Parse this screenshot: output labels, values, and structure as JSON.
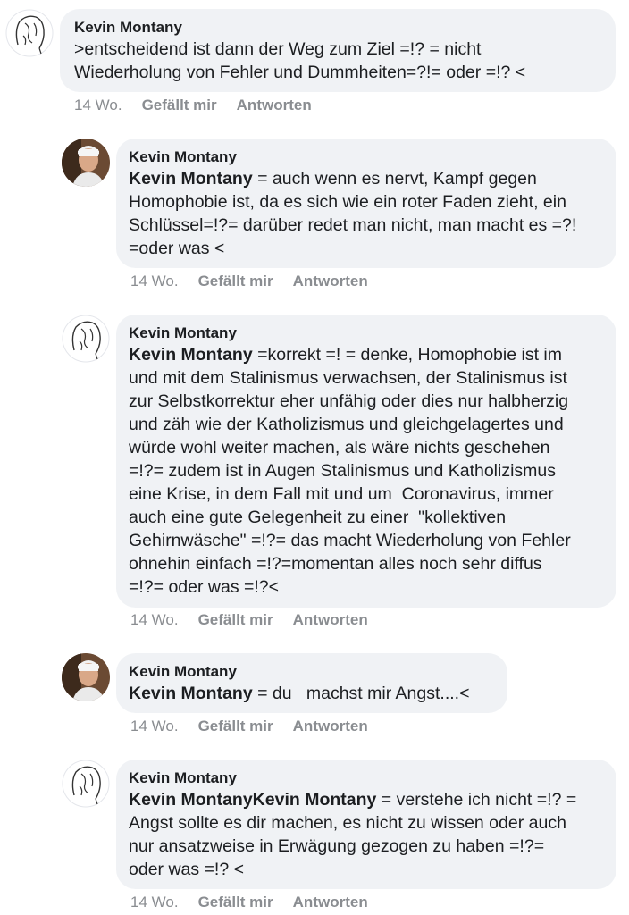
{
  "comments": [
    {
      "author": "Kevin Montany",
      "mention": "",
      "text": ">entscheidend ist dann der Weg zum Ziel =!? = nicht\nWiederholung von Fehler und Dummheiten=?!= oder =!? <",
      "time": "14 Wo.",
      "like": "Gefällt mir",
      "reply": "Antworten",
      "avatar_icon": "sketch-face-avatar"
    },
    {
      "author": "Kevin Montany",
      "mention": "Kevin Montany",
      "text": " = auch wenn es nervt, Kampf gegen\nHomophobie ist, da es sich wie ein roter Faden zieht, ein\nSchlüssel=!?= darüber redet man nicht, man macht es =?!\n=oder was <",
      "time": "14 Wo.",
      "like": "Gefällt mir",
      "reply": "Antworten",
      "avatar_icon": "photo-avatar"
    },
    {
      "author": "Kevin Montany",
      "mention": "Kevin Montany",
      "text": " =korrekt =! = denke, Homophobie ist im\nund mit dem Stalinismus verwachsen, der Stalinismus ist\nzur Selbstkorrektur eher unfähig oder dies nur halbherzig\nund zäh wie der Katholizismus und gleichgelagertes und\nwürde wohl weiter machen, als wäre nichts geschehen\n=!?= zudem ist in Augen Stalinismus und Katholizismus\neine Krise, in dem Fall mit und um  Coronavirus, immer\nauch eine gute Gelegenheit zu einer  \"kollektiven\nGehirnwäsche\" =!?= das macht Wiederholung von Fehler\nohnehin einfach =!?=momentan alles noch sehr diffus\n=!?= oder was =!?<",
      "time": "14 Wo.",
      "like": "Gefällt mir",
      "reply": "Antworten",
      "avatar_icon": "sketch-face-avatar"
    },
    {
      "author": "Kevin Montany",
      "mention": "Kevin Montany",
      "text": " = du   machst mir Angst....<",
      "time": "14 Wo.",
      "like": "Gefällt mir",
      "reply": "Antworten",
      "avatar_icon": "photo-avatar"
    },
    {
      "author": "Kevin Montany",
      "mention": "Kevin MontanyKevin Montany",
      "text": " = verstehe ich nicht =!? =\nAngst sollte es dir machen, es nicht zu wissen oder auch\nnur ansatzweise in Erwägung gezogen zu haben =!?=\noder was =!? <",
      "time": "14 Wo.",
      "like": "Gefällt mir",
      "reply": "Antworten",
      "avatar_icon": "sketch-face-avatar"
    }
  ]
}
